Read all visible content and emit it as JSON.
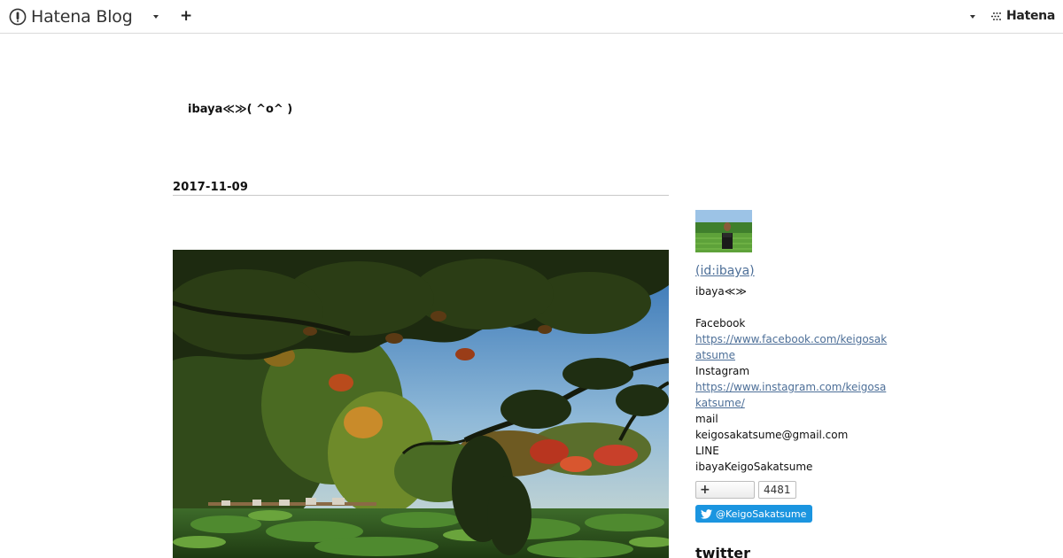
{
  "topbar": {
    "logo_text": "Hatena Blog",
    "brand_text": "Hatena"
  },
  "blog": {
    "title": "ibaya≪≫( ^o^ )"
  },
  "article": {
    "date": "2017-11-09"
  },
  "sidebar": {
    "profile_id": " (id:ibaya)",
    "nickname": "ibaya≪≫",
    "links": [
      {
        "label": "Facebook",
        "url": "https://www.facebook.com/keigosakatsume"
      },
      {
        "label": "Instagram",
        "url": "https://www.instagram.com/keigosakatsume/"
      }
    ],
    "contact": [
      {
        "label": "mail",
        "value": "keigosakatsume@gmail.com"
      },
      {
        "label": "LINE",
        "value": "ibayaKeigoSakatsume"
      }
    ],
    "bookmark_count": "4481",
    "twitter_follow": "@KeigoSakatsume",
    "twitter_heading": "twitter"
  },
  "colors": {
    "link": "#4d6f98",
    "twitter_button": "#1b95e0",
    "divider": "#c9c9c9"
  },
  "icons": {
    "logo": "hatena-blog-logo-icon",
    "brand": "hatena-brand-icon",
    "add": "plus-icon",
    "menu": "caret-down-icon",
    "twitter": "twitter-bird-icon"
  }
}
